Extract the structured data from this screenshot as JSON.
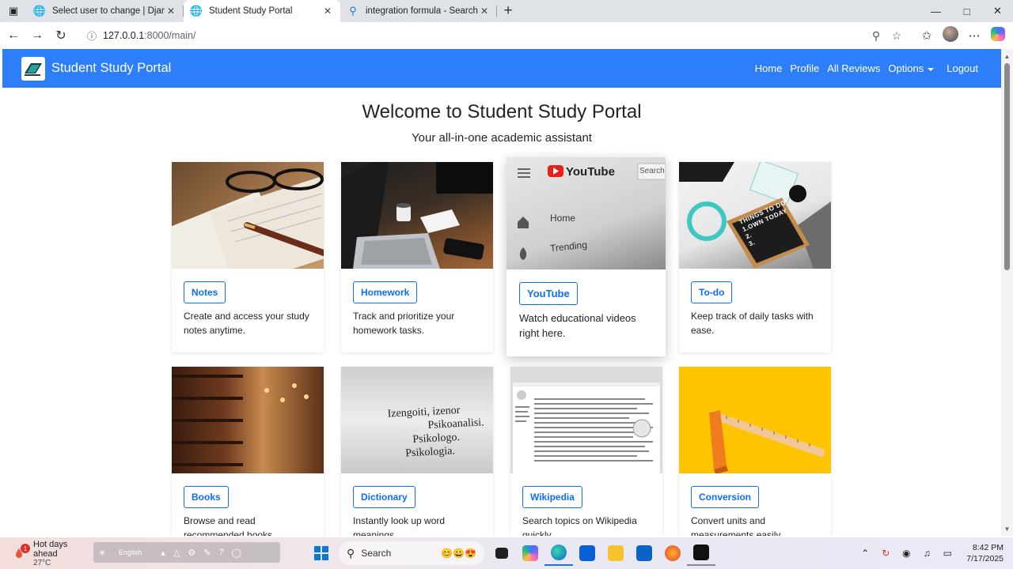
{
  "browser": {
    "tabs": [
      {
        "title": "Select user to change | Django sit",
        "icon": "globe-icon",
        "active": false
      },
      {
        "title": "Student Study Portal",
        "icon": "globe-icon",
        "active": true
      },
      {
        "title": "integration formula - Search",
        "icon": "search-icon",
        "active": false
      }
    ],
    "address": {
      "host": "127.0.0.1",
      "rest": ":8000/main/"
    }
  },
  "site": {
    "brand": "Student Study Portal",
    "nav": [
      "Home",
      "Profile",
      "All Reviews",
      "Options",
      "Logout"
    ],
    "welcome": "Welcome to Student Study Portal",
    "subtitle": "Your all-in-one academic assistant",
    "colors": {
      "navbar": "#2d7ff9",
      "button_outline": "#0d6efd"
    },
    "cards": [
      {
        "label": "Notes",
        "desc": "Create and access your study notes anytime.",
        "image": "notebook-pen-glasses"
      },
      {
        "label": "Homework",
        "desc": "Track and prioritize your homework tasks.",
        "image": "laptop-desk-coffee"
      },
      {
        "label": "YouTube",
        "desc": "Watch educational videos right here.",
        "image": "youtube-screen"
      },
      {
        "label": "To-do",
        "desc": "Keep track of daily tasks with ease.",
        "image": "chalkboard-todo"
      },
      {
        "label": "Books",
        "desc": "Browse and read recommended books.",
        "image": "library-shelves"
      },
      {
        "label": "Dictionary",
        "desc": "Instantly look up word meanings.",
        "image": "dictionary-page"
      },
      {
        "label": "Wikipedia",
        "desc": "Search topics on Wikipedia quickly.",
        "image": "wikipedia-page"
      },
      {
        "label": "Conversion",
        "desc": "Convert units and measurements easily.",
        "image": "ruler-yellow"
      }
    ],
    "yt_image": {
      "logo": "YouTube",
      "search": "Search",
      "menu": [
        "Home",
        "Trending"
      ]
    },
    "todo_image": {
      "board": [
        "THINGS TO DO",
        "1.OWN TODAY",
        "2.",
        "3."
      ]
    },
    "dict_image": {
      "words": [
        "Izengoiti, izenor",
        "Psikoanalisi.",
        "Psikologo.",
        "Psikologia."
      ]
    }
  },
  "taskbar": {
    "weather_title": "Hot days ahead",
    "weather_temp": "27°C",
    "weather_badge": "1",
    "lang": "English",
    "search_placeholder": "Search",
    "time": "8:42 PM",
    "date": "7/17/2025"
  }
}
